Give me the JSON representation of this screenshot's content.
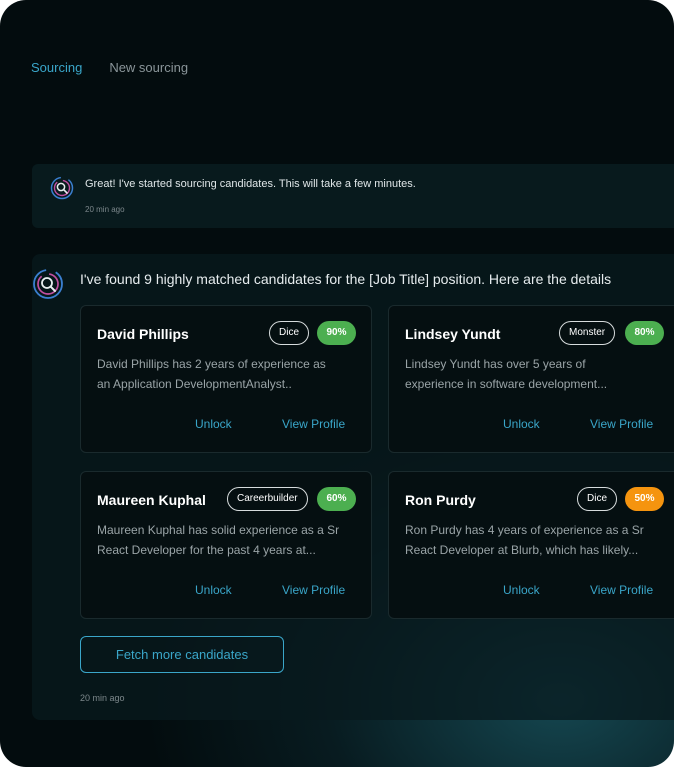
{
  "tabs": [
    {
      "label": "Sourcing",
      "active": true
    },
    {
      "label": "New sourcing",
      "active": false
    }
  ],
  "messages": {
    "started": {
      "text": "Great! I've started sourcing candidates. This will take a few minutes.",
      "time": "20 min ago"
    },
    "results": {
      "headline": "I've found 9 highly matched candidates for the [Job Title] position. Here are the details",
      "time": "20 min ago",
      "fetch_label": "Fetch more candidates"
    }
  },
  "candidates": [
    {
      "name": "David Phillips",
      "source": "Dice",
      "score": "90%",
      "desc_line1": "David Phillips has 2 years of experience as",
      "desc_line2": "an Application DevelopmentAnalyst..",
      "unlock": "Unlock",
      "view": "View Profile"
    },
    {
      "name": "Lindsey Yundt",
      "source": "Monster",
      "score": "80%",
      "desc_line1": "Lindsey Yundt has over 5 years of",
      "desc_line2": "experience in software development...",
      "unlock": "Unlock",
      "view": "View Profile"
    },
    {
      "name": "Maureen Kuphal",
      "source": "Careerbuilder",
      "score": "60%",
      "desc_line1": "Maureen Kuphal has solid experience as a Sr",
      "desc_line2": "React Developer for the past 4 years at...",
      "unlock": "Unlock",
      "view": "View Profile"
    },
    {
      "name": "Ron Purdy",
      "source": "Dice",
      "score": "50%",
      "desc_line1": "Ron Purdy has 4 years of experience as a Sr",
      "desc_line2": "React Developer at Blurb, which has likely...",
      "unlock": "Unlock",
      "view": "View Profile"
    }
  ],
  "colors": {
    "accent": "#3aa6c9",
    "score_high": "#4caf50",
    "score_mid": "#f5940f",
    "background": "#030c0e"
  },
  "icons": {
    "assistant_avatar": "ai-assistant-icon"
  }
}
